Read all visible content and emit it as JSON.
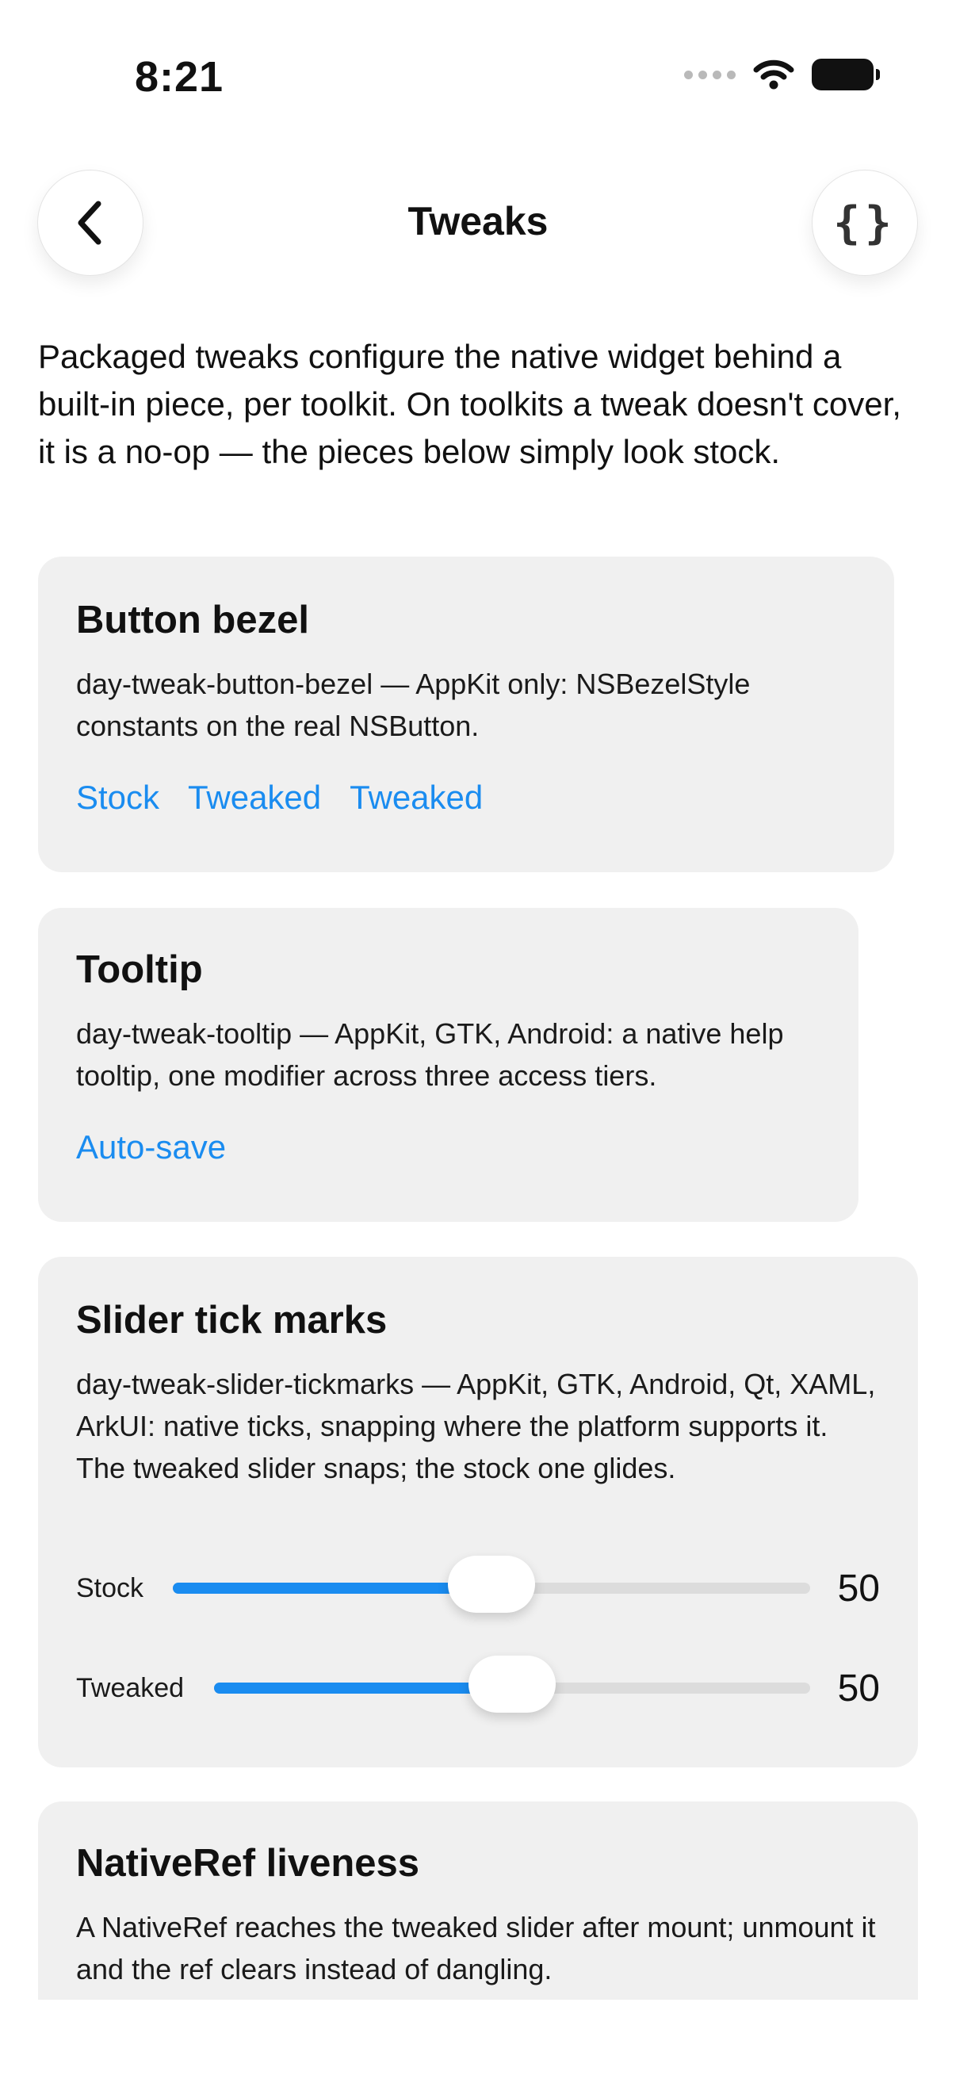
{
  "status_bar": {
    "time": "8:21",
    "icons": [
      "signal-dots-icon",
      "wifi-icon",
      "battery-icon"
    ]
  },
  "nav": {
    "title": "Tweaks",
    "back_icon": "chevron-left-icon",
    "code_icon": "braces-icon",
    "code_glyph": "{}"
  },
  "intro": "Packaged tweaks configure the native widget behind a built-in piece, per toolkit. On toolkits a tweak doesn't cover, it is a no-op — the pieces below simply look stock.",
  "cards": [
    {
      "title": "Button bezel",
      "description": "day-tweak-button-bezel — AppKit only: NSBezelStyle constants on the real NSButton.",
      "links": [
        "Stock",
        "Tweaked",
        "Tweaked"
      ]
    },
    {
      "title": "Tooltip",
      "description": "day-tweak-tooltip — AppKit, GTK, Android: a native help tooltip, one modifier across three access tiers.",
      "links": [
        "Auto-save"
      ]
    },
    {
      "title": "Slider tick marks",
      "description": "day-tweak-slider-tickmarks — AppKit, GTK, Android, Qt, XAML, ArkUI: native ticks, snapping where the platform supports it. The tweaked slider snaps; the stock one glides.",
      "sliders": [
        {
          "label": "Stock",
          "value": "50",
          "fraction": 0.5
        },
        {
          "label": "Tweaked",
          "value": "50",
          "fraction": 0.5
        }
      ]
    },
    {
      "title": "NativeRef liveness",
      "description": "A NativeRef reaches the tweaked slider after mount; unmount it and the ref clears instead of dangling."
    }
  ],
  "colors": {
    "accent": "#1a8cf0",
    "card_background": "#f0f0f0",
    "track": "#dcdcdc"
  }
}
